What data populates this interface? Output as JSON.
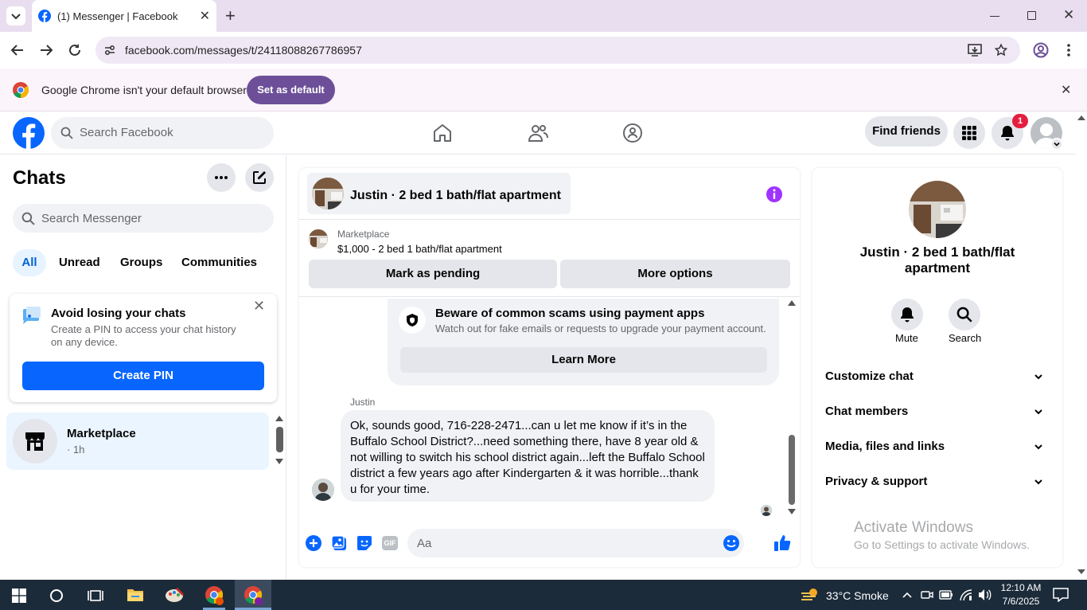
{
  "browser": {
    "tab_title": "(1) Messenger | Facebook",
    "url": "facebook.com/messages/t/24118088267786957",
    "infobar_message": "Google Chrome isn't your default browser",
    "set_default_label": "Set as default"
  },
  "fb_header": {
    "search_placeholder": "Search Facebook",
    "find_friends_label": "Find friends",
    "notification_count": "1"
  },
  "left": {
    "title": "Chats",
    "search_placeholder": "Search Messenger",
    "filters": [
      "All",
      "Unread",
      "Groups",
      "Communities"
    ],
    "pin_card": {
      "title": "Avoid losing your chats",
      "description": "Create a PIN to access your chat history on any device.",
      "button": "Create PIN"
    },
    "conversation": {
      "name": "Marketplace",
      "subtitle": "· 1h"
    }
  },
  "chat": {
    "header_name": "Justin · 2 bed 1 bath/flat apartment",
    "marketplace_label": "Marketplace",
    "listing": "$1,000 - 2 bed 1 bath/flat apartment",
    "mark_pending": "Mark as pending",
    "more_options": "More options",
    "scam_title": "Beware of common scams using payment apps",
    "scam_desc": "Watch out for fake emails or requests to upgrade your payment account.",
    "learn_more": "Learn More",
    "sender": "Justin",
    "message": "Ok, sounds good, 716-228-2471...can u let me know if it’s in the Buffalo School District?...need something there, have 8 year old & not willing to switch his school district again...left the Buffalo School district a few years ago after Kindergarten & it was horrible...thank u for your time.",
    "composer_placeholder": "Aa"
  },
  "right": {
    "name": "Justin · 2 bed 1 bath/flat apartment",
    "mute": "Mute",
    "search": "Search",
    "rows": [
      "Customize chat",
      "Chat members",
      "Media, files and links",
      "Privacy & support"
    ]
  },
  "watermark": {
    "line1": "Activate Windows",
    "line2": "Go to Settings to activate Windows."
  },
  "taskbar": {
    "weather": "33°C  Smoke",
    "time": "12:10 AM",
    "date": "7/6/2025"
  },
  "colors": {
    "fb_blue": "#0866ff",
    "tab_strip": "#e8def0",
    "set_default": "#6c4f98",
    "taskbar": "#1c2b3a"
  }
}
